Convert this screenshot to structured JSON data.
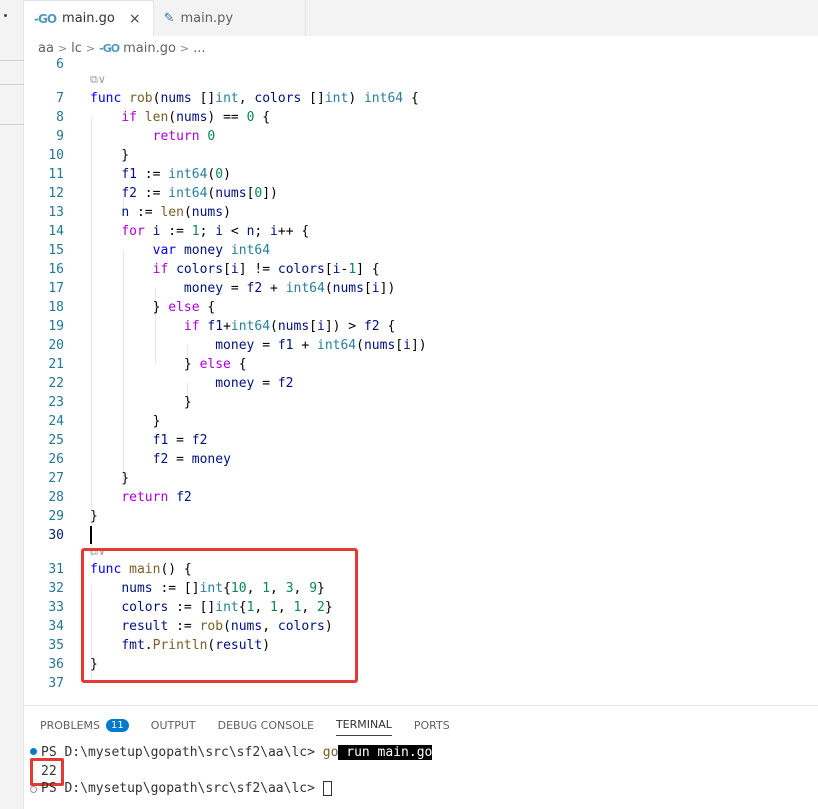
{
  "tabs": [
    {
      "label": "main.go",
      "icon": "go-file-icon",
      "active": true
    },
    {
      "label": "main.py",
      "icon": "python-file-icon",
      "active": false
    }
  ],
  "tab_close": "×",
  "go_icon_glyph": "-GO",
  "py_icon_glyph": "✎",
  "breadcrumb": [
    "aa",
    "lc",
    "main.go",
    "..."
  ],
  "codelens_glyph": "⧉∨",
  "code_lines": [
    {
      "n": "6"
    },
    {
      "n": "7"
    },
    {
      "n": "8"
    },
    {
      "n": "9"
    },
    {
      "n": "10"
    },
    {
      "n": "11"
    },
    {
      "n": "12"
    },
    {
      "n": "13"
    },
    {
      "n": "14"
    },
    {
      "n": "15"
    },
    {
      "n": "16"
    },
    {
      "n": "17"
    },
    {
      "n": "18"
    },
    {
      "n": "19"
    },
    {
      "n": "20"
    },
    {
      "n": "21"
    },
    {
      "n": "22"
    },
    {
      "n": "23"
    },
    {
      "n": "24"
    },
    {
      "n": "25"
    },
    {
      "n": "26"
    },
    {
      "n": "27"
    },
    {
      "n": "28"
    },
    {
      "n": "29"
    },
    {
      "n": "30"
    },
    {
      "n": "31"
    },
    {
      "n": "32"
    },
    {
      "n": "33"
    },
    {
      "n": "34"
    },
    {
      "n": "35"
    },
    {
      "n": "36"
    },
    {
      "n": "37"
    }
  ],
  "panel": {
    "tabs": [
      "PROBLEMS",
      "OUTPUT",
      "DEBUG CONSOLE",
      "TERMINAL",
      "PORTS"
    ],
    "problems_count": "11",
    "active_tab": "TERMINAL"
  },
  "terminal": {
    "prompt1": "PS D:\\mysetup\\gopath\\src\\sf2\\aa\\lc> ",
    "cmd_go": "go",
    "cmd_rest": " run main.go",
    "output": "22",
    "prompt2": "PS D:\\mysetup\\gopath\\src\\sf2\\aa\\lc> "
  },
  "colors": {
    "accent": "#007acc",
    "highlight_border": "#e53935",
    "keyword": "#0000ff",
    "type": "#267f99",
    "function": "#795e26",
    "number": "#098658"
  }
}
